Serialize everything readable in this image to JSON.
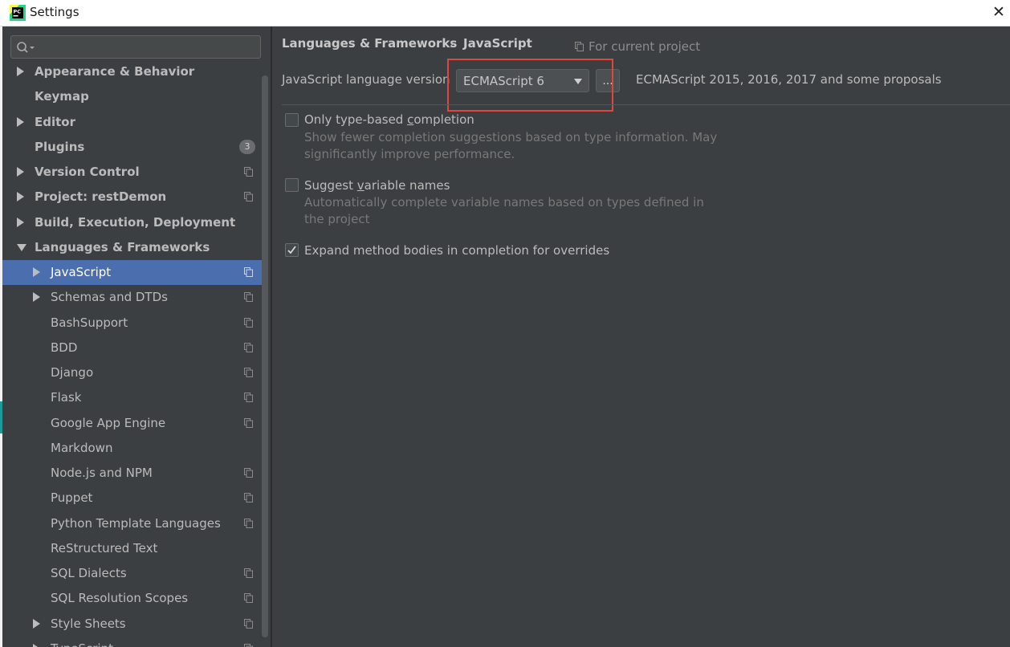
{
  "window": {
    "title": "Settings",
    "close_glyph": "✕"
  },
  "search": {
    "placeholder": "",
    "icon": "search-icon"
  },
  "sidebar": {
    "items": [
      {
        "label": "Appearance & Behavior",
        "bold": true,
        "arrow": "right",
        "indent": 0
      },
      {
        "label": "Keymap",
        "bold": true,
        "arrow": "",
        "indent": 0
      },
      {
        "label": "Editor",
        "bold": true,
        "arrow": "right",
        "indent": 0
      },
      {
        "label": "Plugins",
        "bold": true,
        "arrow": "",
        "indent": 0,
        "badge": "3"
      },
      {
        "label": "Version Control",
        "bold": true,
        "arrow": "right",
        "indent": 0,
        "project_icon": true
      },
      {
        "label": "Project: restDemon",
        "bold": true,
        "arrow": "right",
        "indent": 0,
        "project_icon": true
      },
      {
        "label": "Build, Execution, Deployment",
        "bold": true,
        "arrow": "right",
        "indent": 0
      },
      {
        "label": "Languages & Frameworks",
        "bold": true,
        "arrow": "down",
        "indent": 0
      },
      {
        "label": "JavaScript",
        "bold": false,
        "arrow": "right",
        "indent": 1,
        "project_icon": true,
        "selected": true
      },
      {
        "label": "Schemas and DTDs",
        "bold": false,
        "arrow": "right",
        "indent": 1,
        "project_icon": true
      },
      {
        "label": "BashSupport",
        "bold": false,
        "arrow": "",
        "indent": 1,
        "project_icon": true
      },
      {
        "label": "BDD",
        "bold": false,
        "arrow": "",
        "indent": 1,
        "project_icon": true
      },
      {
        "label": "Django",
        "bold": false,
        "arrow": "",
        "indent": 1,
        "project_icon": true
      },
      {
        "label": "Flask",
        "bold": false,
        "arrow": "",
        "indent": 1,
        "project_icon": true
      },
      {
        "label": "Google App Engine",
        "bold": false,
        "arrow": "",
        "indent": 1,
        "project_icon": true
      },
      {
        "label": "Markdown",
        "bold": false,
        "arrow": "",
        "indent": 1
      },
      {
        "label": "Node.js and NPM",
        "bold": false,
        "arrow": "",
        "indent": 1,
        "project_icon": true
      },
      {
        "label": "Puppet",
        "bold": false,
        "arrow": "",
        "indent": 1,
        "project_icon": true
      },
      {
        "label": "Python Template Languages",
        "bold": false,
        "arrow": "",
        "indent": 1,
        "project_icon": true
      },
      {
        "label": "ReStructured Text",
        "bold": false,
        "arrow": "",
        "indent": 1
      },
      {
        "label": "SQL Dialects",
        "bold": false,
        "arrow": "",
        "indent": 1,
        "project_icon": true
      },
      {
        "label": "SQL Resolution Scopes",
        "bold": false,
        "arrow": "",
        "indent": 1,
        "project_icon": true
      },
      {
        "label": "Style Sheets",
        "bold": false,
        "arrow": "right",
        "indent": 1,
        "project_icon": true
      },
      {
        "label": "TypeScript",
        "bold": false,
        "arrow": "right",
        "indent": 1,
        "project_icon": true
      }
    ]
  },
  "breadcrumb": {
    "parent": "Languages & Frameworks",
    "separator": "›",
    "current": "JavaScript"
  },
  "scope": {
    "label": "For current project",
    "icon": "project-scope-icon"
  },
  "js_version": {
    "label": "JavaScript language version",
    "selected": "ECMAScript 6",
    "more_button": "...",
    "description": "ECMAScript 2015, 2016, 2017 and some proposals"
  },
  "options": [
    {
      "label_before": "Only type-based ",
      "mnemonic": "c",
      "label_after": "ompletion",
      "checked": false,
      "description": "Show fewer completion suggestions based on type information. May significantly improve performance."
    },
    {
      "label_before": "Suggest ",
      "mnemonic": "v",
      "label_after": "ariable names",
      "checked": false,
      "description": "Automatically complete variable names based on types defined in the project"
    },
    {
      "label_before": "Expand method bodies in completion for overrides",
      "mnemonic": "",
      "label_after": "",
      "checked": true,
      "description": ""
    }
  ],
  "colors": {
    "selection": "#4b6eaf",
    "highlight_box": "#e0463e",
    "background": "#3c3f41"
  }
}
